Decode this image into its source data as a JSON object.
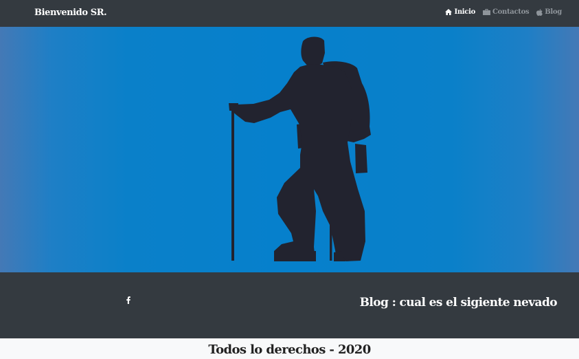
{
  "navbar": {
    "brand": "Bienvenido SR.",
    "links": [
      {
        "label": "Inicio",
        "icon": "home-icon",
        "active": true
      },
      {
        "label": "Contactos",
        "icon": "briefcase-icon",
        "active": false
      },
      {
        "label": "Blog",
        "icon": "apple-icon",
        "active": false
      }
    ]
  },
  "hero": {
    "image": "hiker-silhouette"
  },
  "footer": {
    "social_icon": "facebook-icon",
    "blog_title": "Blog : cual es el sigiente nevado",
    "copyright": "Todos lo derechos - 2020"
  },
  "colors": {
    "navbar_bg": "#343a40",
    "hero_blue": "#0680cc",
    "silhouette": "#22232f",
    "footer_bg": "#343a40",
    "page_bg": "#f8f9fa"
  }
}
